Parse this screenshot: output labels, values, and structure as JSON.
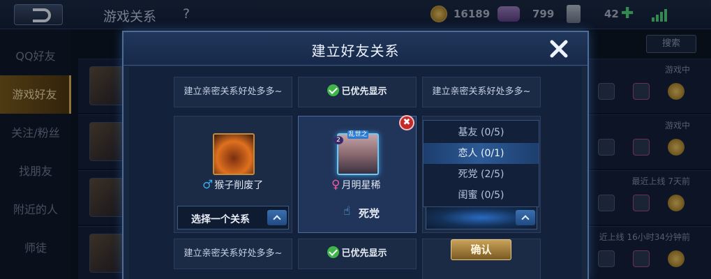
{
  "topbar": {
    "title": "游戏关系",
    "help": "?",
    "gold": "16189",
    "diamonds": "799",
    "cards": "42",
    "plus": "✚"
  },
  "sidebar": {
    "items": [
      {
        "label": "QQ好友"
      },
      {
        "label": "游戏好友"
      },
      {
        "label": "关注/粉丝"
      },
      {
        "label": "找朋友"
      },
      {
        "label": "附近的人"
      },
      {
        "label": "师徒"
      }
    ]
  },
  "background_list": {
    "search_label": "搜索",
    "rows": [
      {
        "status": "游戏中"
      },
      {
        "status": "游戏中"
      },
      {
        "status": "最近上线  7天前"
      },
      {
        "status": "近上线  16小时34分钟前"
      }
    ]
  },
  "dialog": {
    "title": "建立好友关系",
    "close": "✕",
    "tip_top_left": "建立亲密关系好处多多~",
    "tip_top_mid": "已优先显示",
    "tip_top_right": "建立亲密关系好处多多~",
    "tip_bottom_left": "建立亲密关系好处多多~",
    "tip_bottom_mid": "已优先显示",
    "left_card": {
      "gender_symbol": "♂",
      "name": "猴子削废了",
      "select_label": "选择一个关系"
    },
    "mid_card": {
      "badge": "2",
      "frame_text": "乱世之",
      "gender_symbol": "♀",
      "name": "月明星稀",
      "relation": "死党",
      "remove": "✖"
    },
    "dropdown": {
      "options": [
        {
          "label": "基友 (0/5)"
        },
        {
          "label": "恋人 (0/1)"
        },
        {
          "label": "死党 (2/5)"
        },
        {
          "label": "闺蜜 (0/5)"
        }
      ],
      "selected_index": 1
    },
    "confirm_label": "确认"
  }
}
